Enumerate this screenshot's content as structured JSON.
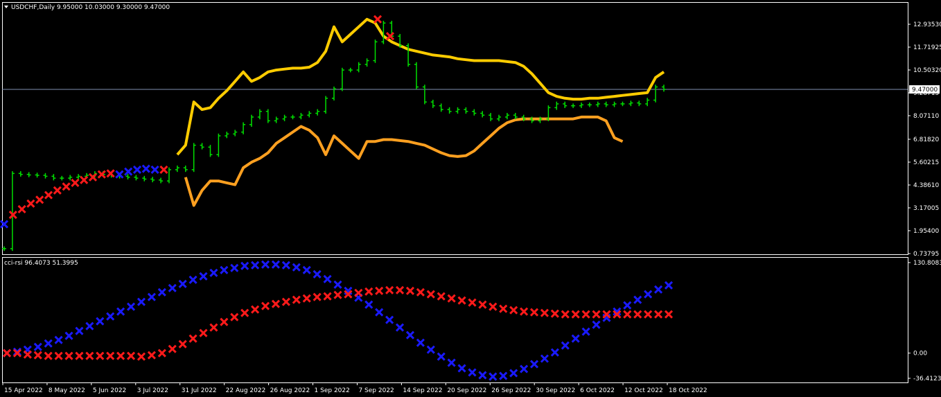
{
  "header": {
    "symbol_line": "USDCHF,Daily  9.95000 10.03000 9.30000 9.47000",
    "indicator_line": "cci-rsi 96.4073 51.3995"
  },
  "colors": {
    "background": "#000000",
    "frame": "#ffffff",
    "bars": "#00e000",
    "upper_band": "#ffcc00",
    "lower_band": "#ffa020",
    "cross_red": "#ff1a1a",
    "cross_blue": "#1a1aff",
    "price_line": "#8090b0"
  },
  "chart_data": [
    {
      "type": "ohlc",
      "title": "USDCHF,Daily",
      "y_ticks": [
        "12.93530",
        "11.71925",
        "10.50320",
        "9.28715",
        "8.07110",
        "6.81820",
        "5.60215",
        "4.38610",
        "3.17005",
        "1.95400",
        "0.73795"
      ],
      "ylim": [
        0.5,
        13.6
      ],
      "x_ticks": [
        "15 Apr 2022",
        "8 May 2022",
        "5 Jun 2022",
        "3 Jul 2022",
        "31 Jul 2022",
        "22 Aug 2022",
        "26 Aug 2022",
        "1 Sep 2022",
        "7 Sep 2022",
        "14 Sep 2022",
        "20 Sep 2022",
        "26 Sep 2022",
        "30 Sep 2022",
        "6 Oct 2022",
        "12 Oct 2022",
        "18 Oct 2022"
      ],
      "current_price": 9.47,
      "current_price_label": "9.47000",
      "bar_close": [
        1.0,
        5.0,
        4.95,
        4.92,
        4.9,
        4.85,
        4.75,
        4.75,
        4.8,
        4.85,
        4.9,
        5.0,
        4.95,
        4.9,
        4.85,
        4.8,
        4.75,
        4.7,
        4.65,
        4.6,
        5.2,
        5.3,
        5.2,
        6.5,
        6.4,
        6.0,
        7.0,
        7.1,
        7.2,
        7.6,
        8.0,
        8.3,
        7.8,
        7.9,
        8.0,
        8.0,
        8.1,
        8.2,
        8.3,
        9.0,
        9.5,
        10.5,
        10.5,
        10.8,
        11.0,
        12.0,
        13.0,
        12.3,
        11.8,
        10.8,
        9.6,
        8.8,
        8.6,
        8.4,
        8.3,
        8.4,
        8.3,
        8.2,
        8.1,
        7.9,
        8.0,
        8.1,
        8.0,
        7.9,
        7.8,
        7.9,
        8.5,
        8.7,
        8.6,
        8.6,
        8.65,
        8.65,
        8.7,
        8.65,
        8.7,
        8.7,
        8.75,
        8.7,
        8.9,
        9.6,
        9.47
      ],
      "upper_band": [
        null,
        null,
        null,
        null,
        null,
        null,
        null,
        null,
        null,
        null,
        null,
        null,
        null,
        null,
        null,
        null,
        null,
        null,
        null,
        null,
        null,
        6.0,
        6.5,
        8.8,
        8.4,
        8.5,
        9.0,
        9.4,
        9.9,
        10.4,
        9.9,
        10.1,
        10.4,
        10.5,
        10.55,
        10.6,
        10.6,
        10.65,
        10.9,
        11.5,
        12.8,
        12.0,
        12.4,
        12.8,
        13.2,
        13.0,
        12.3,
        12.0,
        11.8,
        11.6,
        11.5,
        11.4,
        11.3,
        11.25,
        11.2,
        11.1,
        11.05,
        11.0,
        11.0,
        11.0,
        11.0,
        10.95,
        10.9,
        10.7,
        10.3,
        9.8,
        9.3,
        9.1,
        9.0,
        8.95,
        8.95,
        9.0,
        9.0,
        9.05,
        9.1,
        9.15,
        9.2,
        9.25,
        9.3,
        10.1,
        10.4
      ],
      "lower_band": [
        null,
        null,
        null,
        null,
        null,
        null,
        null,
        null,
        null,
        null,
        null,
        null,
        null,
        null,
        null,
        null,
        null,
        null,
        null,
        null,
        null,
        null,
        4.8,
        3.3,
        4.1,
        4.6,
        4.6,
        4.5,
        4.4,
        5.3,
        5.6,
        5.8,
        6.1,
        6.6,
        6.9,
        7.2,
        7.5,
        7.3,
        6.9,
        6.0,
        7.0,
        6.6,
        6.2,
        5.8,
        6.7,
        6.7,
        6.8,
        6.8,
        6.75,
        6.7,
        6.6,
        6.5,
        6.3,
        6.1,
        5.95,
        5.9,
        5.95,
        6.2,
        6.6,
        7.0,
        7.4,
        7.7,
        7.85,
        7.9,
        7.9,
        7.9,
        7.9,
        7.9,
        7.9,
        7.9,
        8.0,
        8.0,
        8.0,
        7.8,
        6.9,
        6.7
      ],
      "cross_markers": [
        {
          "x": 0,
          "y": 2.3,
          "c": "blue"
        },
        {
          "x": 1,
          "y": 2.8,
          "c": "red"
        },
        {
          "x": 2,
          "y": 3.1,
          "c": "red"
        },
        {
          "x": 3,
          "y": 3.4,
          "c": "red"
        },
        {
          "x": 4,
          "y": 3.6,
          "c": "red"
        },
        {
          "x": 5,
          "y": 3.85,
          "c": "red"
        },
        {
          "x": 6,
          "y": 4.1,
          "c": "red"
        },
        {
          "x": 7,
          "y": 4.3,
          "c": "red"
        },
        {
          "x": 8,
          "y": 4.5,
          "c": "red"
        },
        {
          "x": 9,
          "y": 4.65,
          "c": "red"
        },
        {
          "x": 10,
          "y": 4.8,
          "c": "red"
        },
        {
          "x": 11,
          "y": 4.95,
          "c": "red"
        },
        {
          "x": 12,
          "y": 5.0,
          "c": "red"
        },
        {
          "x": 13,
          "y": 4.95,
          "c": "blue"
        },
        {
          "x": 14,
          "y": 5.1,
          "c": "blue"
        },
        {
          "x": 15,
          "y": 5.2,
          "c": "blue"
        },
        {
          "x": 16,
          "y": 5.25,
          "c": "blue"
        },
        {
          "x": 17,
          "y": 5.2,
          "c": "blue"
        },
        {
          "x": 18,
          "y": 5.2,
          "c": "red"
        },
        {
          "x": 19,
          "y": 13.2,
          "c": "red"
        },
        {
          "x": 20,
          "y": 12.3,
          "c": "red"
        }
      ]
    },
    {
      "type": "line",
      "title": "cci-rsi",
      "y_ticks": [
        "130.8083",
        "0.00",
        "-36.4123"
      ],
      "ylim": [
        -36.4123,
        130.8083
      ],
      "series": [
        {
          "values": [
            0,
            2,
            5,
            9,
            14,
            19,
            25,
            32,
            39,
            46,
            53,
            60,
            67,
            74,
            81,
            88,
            94,
            100,
            106,
            111,
            116,
            120,
            123,
            126,
            127,
            128,
            128,
            127,
            124,
            120,
            114,
            107,
            99,
            90,
            80,
            70,
            59,
            48,
            37,
            26,
            15,
            5,
            -5,
            -14,
            -22,
            -28,
            -32,
            -34,
            -33,
            -29,
            -23,
            -16,
            -8,
            1,
            11,
            21,
            31,
            41,
            51,
            60,
            69,
            77,
            85,
            92,
            98
          ]
        },
        {
          "values": [
            0,
            0,
            -2,
            -3,
            -4,
            -4,
            -4,
            -4,
            -4,
            -4,
            -4,
            -4,
            -4,
            -5,
            -3,
            0,
            6,
            13,
            21,
            29,
            37,
            45,
            52,
            58,
            63,
            68,
            71,
            74,
            77,
            79,
            81,
            82,
            84,
            85,
            87,
            89,
            90,
            91,
            91,
            90,
            88,
            85,
            82,
            79,
            76,
            73,
            70,
            67,
            64,
            62,
            60,
            59,
            58,
            57,
            56,
            56,
            56,
            56,
            56,
            56,
            56,
            56,
            56,
            56,
            56
          ]
        }
      ]
    }
  ]
}
